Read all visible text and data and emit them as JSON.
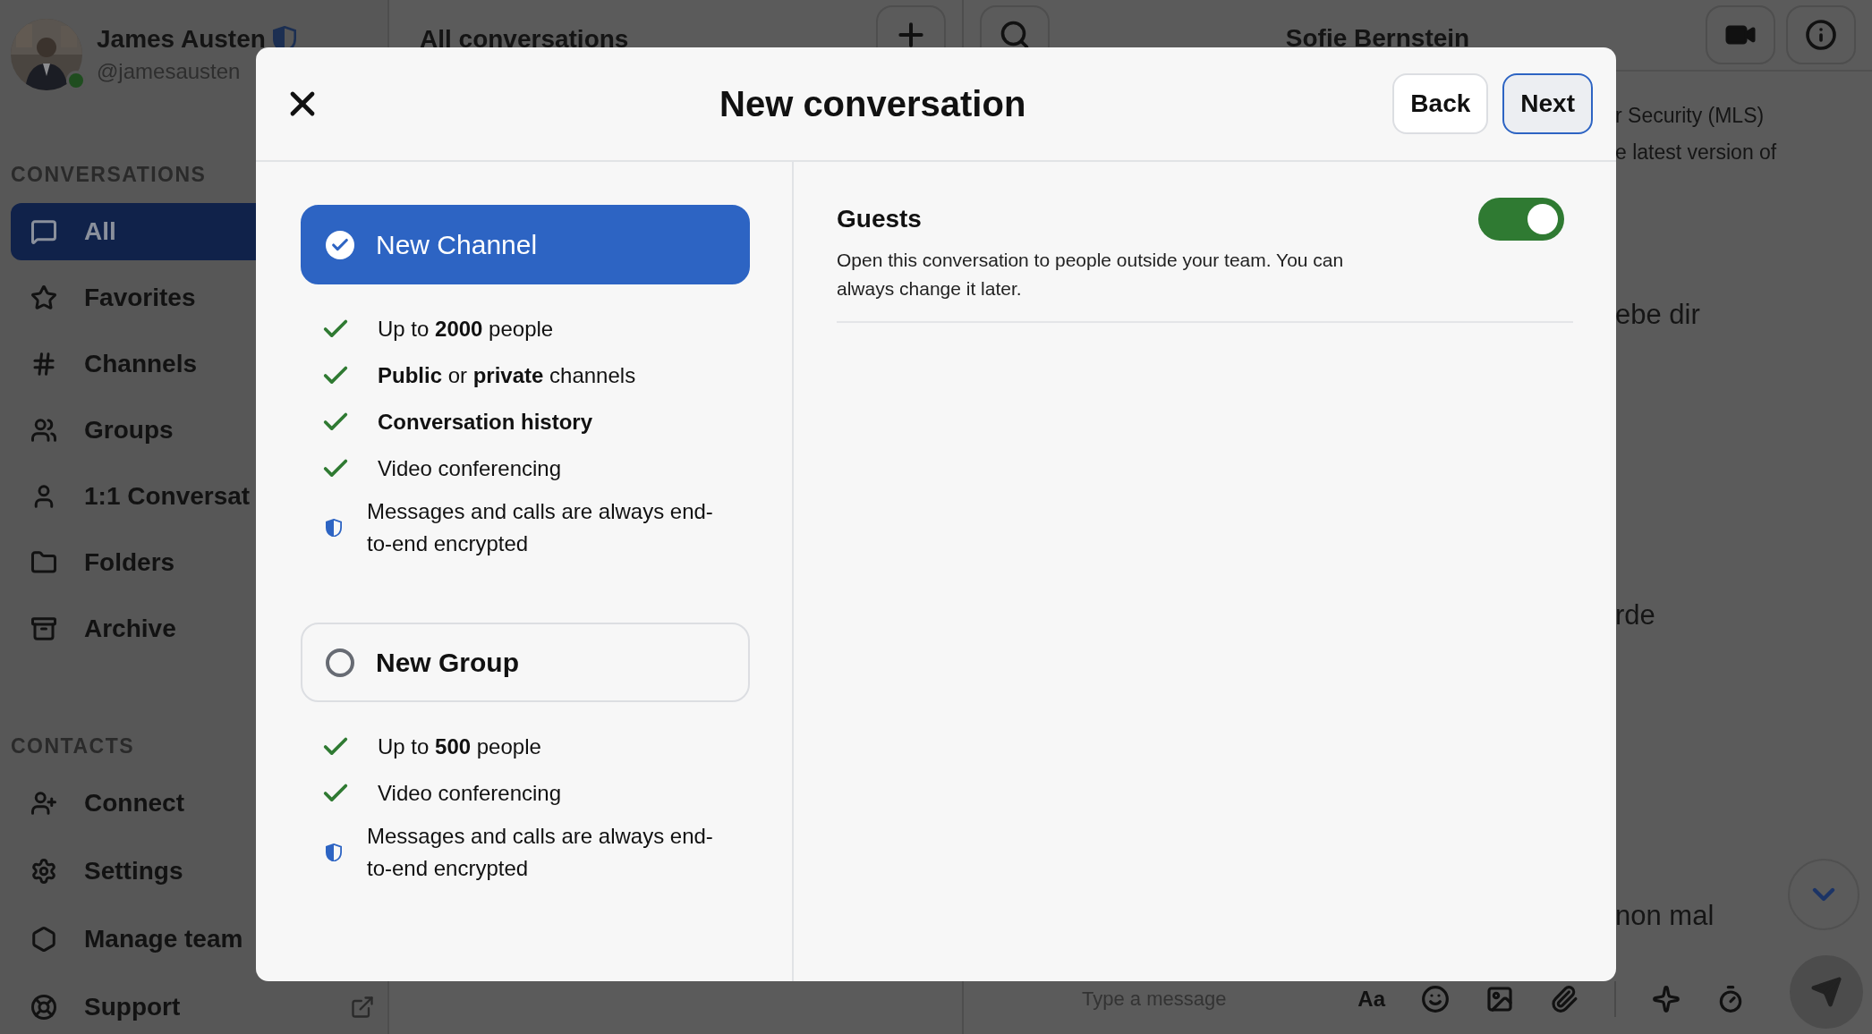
{
  "profile": {
    "name": "James Austen",
    "handle": "@jamesausten",
    "available": true
  },
  "sidebar": {
    "sections": [
      {
        "title": "CONVERSATIONS",
        "items": [
          {
            "label": "All",
            "selected": true
          },
          {
            "label": "Favorites",
            "selected": false
          },
          {
            "label": "Channels",
            "selected": false
          },
          {
            "label": "Groups",
            "selected": false
          },
          {
            "label": "1:1 Conversat",
            "selected": false
          },
          {
            "label": "Folders",
            "selected": false
          },
          {
            "label": "Archive",
            "selected": false
          }
        ]
      },
      {
        "title": "CONTACTS",
        "items": [
          {
            "label": "Connect",
            "selected": false
          },
          {
            "label": "Settings",
            "selected": false
          },
          {
            "label": "Manage team",
            "selected": false
          },
          {
            "label": "Support",
            "selected": false
          }
        ]
      }
    ]
  },
  "conversation_list": {
    "title": "All conversations"
  },
  "chat": {
    "title": "Sofie Bernstein",
    "messages": [
      {
        "kind": "system",
        "text": "r Security (MLS)"
      },
      {
        "kind": "system",
        "text": "e latest version of"
      },
      {
        "kind": "message",
        "text": "ebe dir"
      },
      {
        "kind": "message",
        "text": "rde"
      },
      {
        "kind": "message",
        "text": "non mal"
      }
    ],
    "composer": {
      "placeholder": "Type a message",
      "format_label": "Aa"
    }
  },
  "dialog": {
    "title": "New conversation",
    "buttons": [
      {
        "label": "Back",
        "focused": false
      },
      {
        "label": "Next",
        "focused": true
      }
    ],
    "options": [
      {
        "label": "New Channel",
        "selected": true,
        "features": [
          {
            "kind": "check",
            "text": "Up to **2000** people",
            "bold": false
          },
          {
            "kind": "check",
            "text": "**Public** or **private** channels",
            "bold": false
          },
          {
            "kind": "check",
            "text": "Conversation history",
            "bold": true
          },
          {
            "kind": "check",
            "text": "Video conferencing",
            "bold": false
          },
          {
            "kind": "shield",
            "text": "Messages and calls are always end-to-end encrypted",
            "bold": false
          }
        ]
      },
      {
        "label": "New Group",
        "selected": false,
        "features": [
          {
            "kind": "check",
            "text": "Up to **500** people",
            "bold": false
          },
          {
            "kind": "check",
            "text": "Video conferencing",
            "bold": false
          },
          {
            "kind": "shield",
            "text": "Messages and calls are always end-to-end encrypted",
            "bold": false
          }
        ]
      }
    ],
    "settings": [
      {
        "label": "Guests",
        "description": "Open this conversation to people outside your team. You can always change it later.",
        "on": true
      }
    ]
  }
}
